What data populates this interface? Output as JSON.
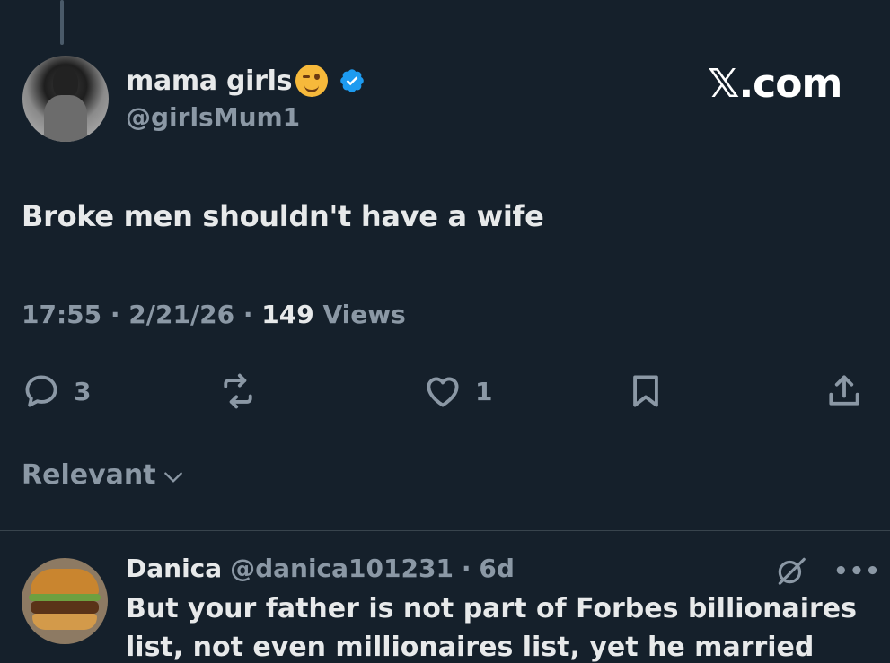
{
  "tweet": {
    "display_name": "mama girls",
    "emoji": "winking-face-emoji",
    "verified_icon": "verified-badge-icon",
    "handle": "@girlsMum1",
    "text": "Broke men shouldn't have a wife",
    "time": "17:55",
    "date": "2/21/26",
    "views_count": "149",
    "views_label": "Views",
    "separator": "·",
    "actions": {
      "replies": "3",
      "likes": "1"
    }
  },
  "watermark": "𝕏.com",
  "sort": {
    "label": "Relevant"
  },
  "reply": {
    "name": "Danica",
    "handle": "@danica101231",
    "age": "6d",
    "text": "But your father is not part of Forbes billionaires",
    "text_cut": "list, not even millionaires list, yet he married"
  },
  "colors": {
    "background": "#15202b",
    "primary_text": "#e7e9ea",
    "secondary_text": "#8b98a5",
    "verified": "#1d9bf0"
  }
}
